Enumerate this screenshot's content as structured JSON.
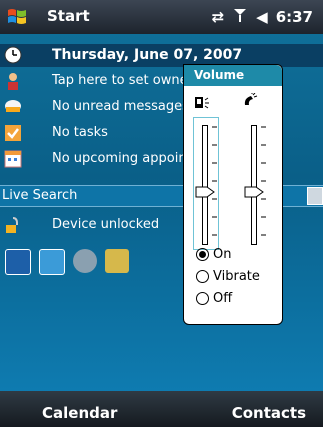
{
  "taskbar": {
    "start_label": "Start",
    "clock": "6:37"
  },
  "today": {
    "date": "Thursday, June 07, 2007",
    "owner_prompt": "Tap here to set owner information",
    "messages": "No unread messages",
    "tasks": "No tasks",
    "appointments": "No upcoming appointments",
    "search_label": "Live Search",
    "device_status": "Device unlocked"
  },
  "volume_popup": {
    "title": "Volume",
    "options": [
      "On",
      "Vibrate",
      "Off"
    ],
    "selected": "On",
    "device_volume_level": 0.45,
    "ringer_volume_level": 0.45
  },
  "softkeys": {
    "left": "Calendar",
    "right": "Contacts"
  },
  "colors": {
    "background": "#0b6e9c",
    "selected_row": "#0a3f63",
    "volume_header": "#1e8aa8"
  },
  "icons": [
    "windows-logo-icon",
    "sync-icon",
    "signal-icon",
    "speaker-icon",
    "clock-icon",
    "owner-icon",
    "mail-icon",
    "tasks-icon",
    "calendar-icon",
    "lock-icon"
  ]
}
